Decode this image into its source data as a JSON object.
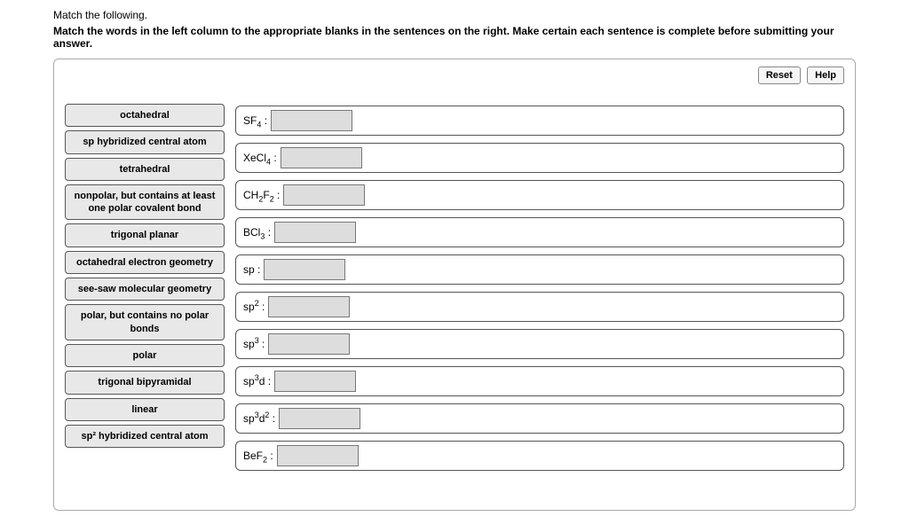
{
  "intro": "Match the following.",
  "instruction": "Match the words in the left column to the appropriate blanks in the sentences on the right. Make certain each sentence is complete before submitting your answer.",
  "buttons": {
    "reset": "Reset",
    "help": "Help"
  },
  "tiles": [
    "octahedral",
    "sp hybridized central atom",
    "tetrahedral",
    "nonpolar, but contains at least one polar covalent bond",
    "trigonal planar",
    "octahedral electron geometry",
    "see-saw molecular geometry",
    "polar, but contains no polar bonds",
    "polar",
    "trigonal bipyramidal",
    "linear",
    "sp² hybridized central atom"
  ],
  "rows": [
    {
      "html": "SF<sub>4</sub> :"
    },
    {
      "html": "XeCl<sub>4</sub> :"
    },
    {
      "html": "CH<sub>2</sub>F<sub>2</sub> :"
    },
    {
      "html": "BCl<sub>3</sub> :"
    },
    {
      "html": "sp :"
    },
    {
      "html": "sp<sup>2</sup> :"
    },
    {
      "html": "sp<sup>3</sup> :"
    },
    {
      "html": "sp<sup>3</sup>d :"
    },
    {
      "html": "sp<sup>3</sup>d<sup>2</sup> :"
    },
    {
      "html": "BeF<sub>2</sub> :"
    }
  ]
}
